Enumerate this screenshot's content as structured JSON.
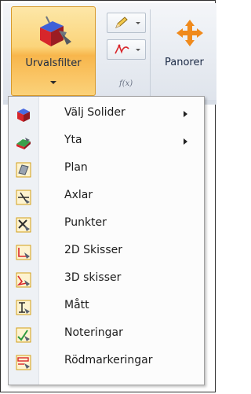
{
  "ribbon": {
    "selection_filter": {
      "label": "Urvalsfilter",
      "icon": "selection-filter-cube-icon"
    },
    "pencil_button": {
      "icon": "pencil-icon"
    },
    "sketch_button": {
      "icon": "sketch-curve-icon"
    },
    "fx_label": "f(x)",
    "pan": {
      "label": "Panorer",
      "icon": "pan-arrows-icon"
    }
  },
  "menu": {
    "items": [
      {
        "label": "Välj Solider",
        "icon": "solid-cube-icon",
        "submenu": true
      },
      {
        "label": "Yta",
        "icon": "surface-icon",
        "submenu": true
      },
      {
        "label": "Plan",
        "icon": "plane-icon",
        "submenu": false
      },
      {
        "label": "Axlar",
        "icon": "axis-icon",
        "submenu": false
      },
      {
        "label": "Punkter",
        "icon": "point-icon",
        "submenu": false
      },
      {
        "label": "2D Skisser",
        "icon": "sketch-2d-icon",
        "submenu": false
      },
      {
        "label": "3D skisser",
        "icon": "sketch-3d-icon",
        "submenu": false
      },
      {
        "label": "Mått",
        "icon": "dimension-icon",
        "submenu": false
      },
      {
        "label": "Noteringar",
        "icon": "annotation-icon",
        "submenu": false
      },
      {
        "label": "Rödmarkeringar",
        "icon": "redline-icon",
        "submenu": false
      }
    ]
  },
  "colors": {
    "active_button": "#f8b64c",
    "menu_background": "#fcfcfc",
    "icon_frame": "#d4a017"
  }
}
